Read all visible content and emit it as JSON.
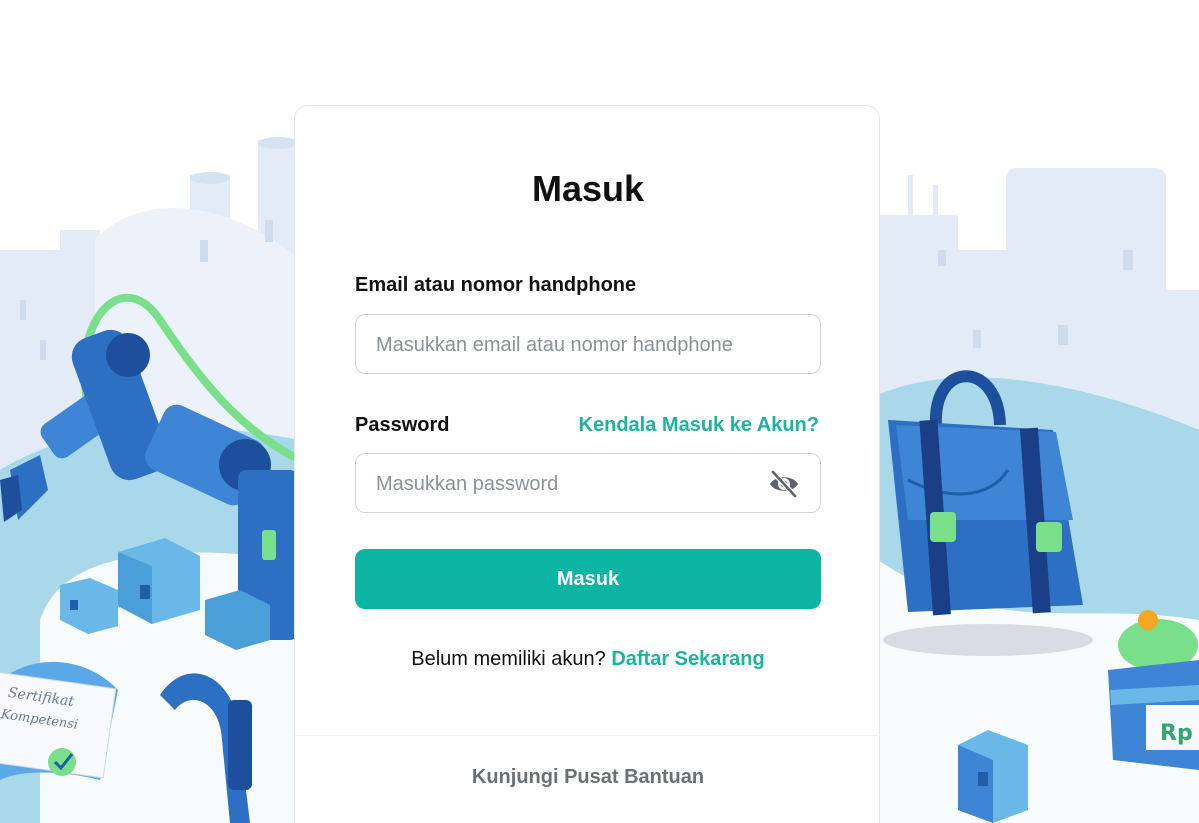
{
  "login": {
    "title": "Masuk",
    "email_label": "Email atau nomor handphone",
    "email_placeholder": "Masukkan email atau nomor handphone",
    "email_value": "",
    "password_label": "Password",
    "forgot_link": "Kendala Masuk ke Akun?",
    "password_placeholder": "Masukkan password",
    "password_value": "",
    "submit_label": "Masuk",
    "register_prompt": "Belum memiliki akun?",
    "register_link": "Daftar Sekarang",
    "help_link": "Kunjungi Pusat Bantuan"
  },
  "icons": {
    "password_toggle": "eye-off-icon"
  },
  "illustrations": {
    "certificate_text_line1": "Sertifikat",
    "certificate_text_line2": "Kompetensi",
    "price_tag": "Rp"
  },
  "colors": {
    "accent": "#0cb5a3",
    "link": "#1bb59c",
    "text": "#111111",
    "muted": "#6b6f76"
  }
}
